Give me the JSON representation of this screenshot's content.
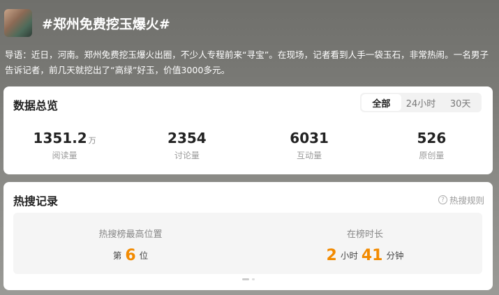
{
  "topic": {
    "title": "#郑州免费挖玉爆火#",
    "intro": "导语：近日，河南。郑州免费挖玉爆火出圈，不少人专程前来“寻宝”。在现场，记者看到人手一袋玉石，非常热闹。一名男子告诉记者，前几天就挖出了“高绿”好玉，价值3000多元。"
  },
  "overview": {
    "title": "数据总览",
    "tabs": [
      {
        "label": "全部",
        "active": true
      },
      {
        "label": "24小时",
        "active": false
      },
      {
        "label": "30天",
        "active": false
      }
    ],
    "stats": [
      {
        "value": "1351.2",
        "unit": "万",
        "label": "阅读量"
      },
      {
        "value": "2354",
        "unit": "",
        "label": "讨论量"
      },
      {
        "value": "6031",
        "unit": "",
        "label": "互动量"
      },
      {
        "value": "526",
        "unit": "",
        "label": "原创量"
      }
    ]
  },
  "hot": {
    "title": "热搜记录",
    "rules_label": "热搜规则",
    "rules_icon": "question-circle-icon",
    "highest": {
      "label": "热搜榜最高位置",
      "prefix": "第",
      "num": "6",
      "suffix": "位"
    },
    "duration": {
      "label": "在榜时长",
      "hours": "2",
      "hours_unit": "小时",
      "minutes": "41",
      "minutes_unit": "分钟"
    },
    "accent_color": "#f28a00"
  }
}
